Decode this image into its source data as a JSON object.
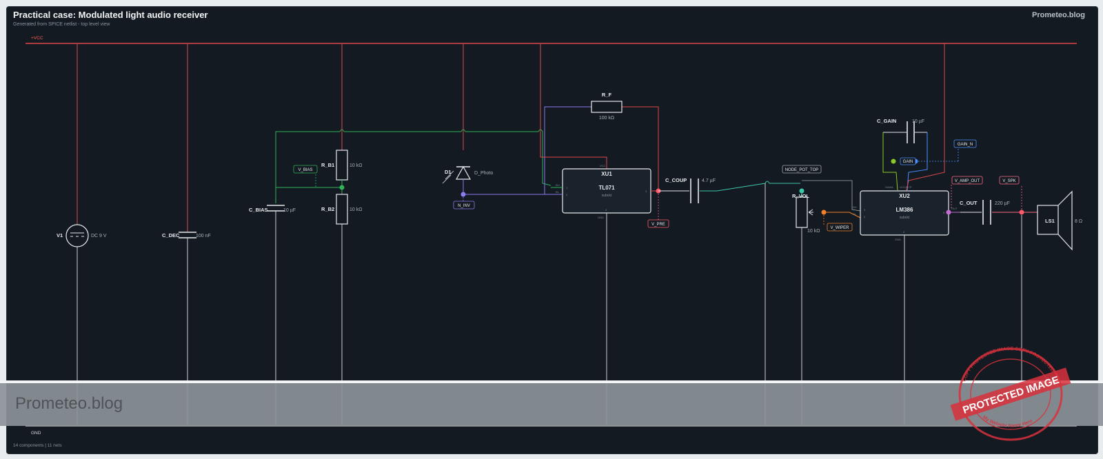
{
  "header": {
    "title": "Practical case: Modulated light audio receiver",
    "subtitle": "Generated from SPICE netlist - top level view",
    "brand": "Prometeo.blog"
  },
  "footer": {
    "summary": "14 components | 11 nets"
  },
  "rails": {
    "vcc": "+VCC",
    "gnd": "GND"
  },
  "components": {
    "v1": {
      "name": "V1",
      "value": "DC 9 V"
    },
    "c_dec": {
      "name": "C_DEC",
      "value": "100 nF"
    },
    "c_bias": {
      "name": "C_BIAS",
      "value": "10 µF"
    },
    "r_b1": {
      "name": "R_B1",
      "value": "10 kΩ"
    },
    "r_b2": {
      "name": "R_B2",
      "value": "10 kΩ"
    },
    "d1": {
      "name": "D1",
      "value": "D_Photo"
    },
    "r_f": {
      "name": "R_F",
      "value": "100 kΩ"
    },
    "xu1": {
      "name": "XU1",
      "part": "TL071",
      "kind": "subckt",
      "pin_vcc": "VCC",
      "pin_gnd": "GND",
      "pin_in_p": "IN+",
      "pin_in_n": "IN-",
      "pin1": "1",
      "pin2": "2",
      "pin_out": "3",
      "pin_bottom": "4"
    },
    "c_coup": {
      "name": "C_COUP",
      "value": "4.7 µF"
    },
    "r_vol": {
      "name": "R_VOL",
      "value": "10 kΩ"
    },
    "c_gain": {
      "name": "C_GAIN",
      "value": "10 µF"
    },
    "xu2": {
      "name": "XU2",
      "part": "LM386",
      "kind": "subckt",
      "pin_top_left": "GAIN1",
      "pin_top_right": "VCC/BYP",
      "pin_gnd": "GND",
      "pin_in_p": "IN+",
      "pin_in_n": "IN-",
      "pin_out": "OUT",
      "pin1": "3",
      "pin2": "2",
      "pin_out_num": "5",
      "pin_bottom": "4"
    },
    "c_out": {
      "name": "C_OUT",
      "value": "220 µF"
    },
    "ls1": {
      "name": "LS1",
      "value": "8 Ω"
    }
  },
  "nets": {
    "v_bias": "V_BIAS",
    "n_inv": "N_INV",
    "v_pre": "V_PRE",
    "node_pot_top": "NODE_POT_TOP",
    "v_wiper": "V_WIPER",
    "gain": "GAIN",
    "gain_n": "GAIN_N",
    "v_amp_out": "V_AMP_OUT",
    "v_spk": "V_SPK"
  },
  "colors": {
    "vcc": "#e0484b",
    "gnd": "#d8d8d8",
    "bias": "#2fb35a",
    "inv": "#8d7cf0",
    "coupling": "#3cc7a8",
    "wiper": "#f0802a",
    "gain_green": "#8ac926",
    "gain_blue": "#4a90ff",
    "spk": "#ff6a8a"
  },
  "overlay": {
    "banner_text": "Prometeo.blog",
    "stamp_main": "PROTECTED IMAGE",
    "stamp_ring_top": "COPY PROTECTED IMAGE COPY PROTECTED",
    "stamp_ring_bottom": "My Website Name Here"
  }
}
